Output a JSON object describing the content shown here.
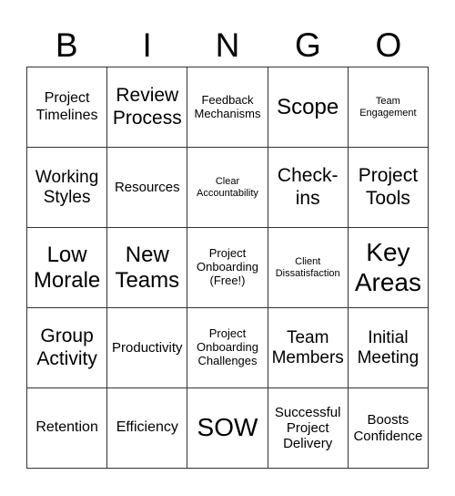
{
  "header": [
    "B",
    "I",
    "N",
    "G",
    "O"
  ],
  "cells": [
    {
      "text": "Project\nTimelines",
      "size": "s16"
    },
    {
      "text": "Review\nProcess",
      "size": "s21"
    },
    {
      "text": "Feedback\nMechanisms",
      "size": "s13"
    },
    {
      "text": "Scope",
      "size": "s24"
    },
    {
      "text": "Team\nEngagement",
      "size": "s12"
    },
    {
      "text": "Working\nStyles",
      "size": "s19"
    },
    {
      "text": "Resources",
      "size": "s15"
    },
    {
      "text": "Clear\nAccountability",
      "size": "s12"
    },
    {
      "text": "Check-\nins",
      "size": "s21"
    },
    {
      "text": "Project\nTools",
      "size": "s21"
    },
    {
      "text": "Low\nMorale",
      "size": "s24"
    },
    {
      "text": "New\nTeams",
      "size": "s24"
    },
    {
      "text": "Project\nOnboarding\n(Free!)",
      "size": "s13"
    },
    {
      "text": "Client\nDissatisfaction",
      "size": "s12"
    },
    {
      "text": "Key\nAreas",
      "size": "s28"
    },
    {
      "text": "Group\nActivity",
      "size": "s21"
    },
    {
      "text": "Productivity",
      "size": "s15"
    },
    {
      "text": "Project\nOnboarding\nChallenges",
      "size": "s13"
    },
    {
      "text": "Team\nMembers",
      "size": "s19"
    },
    {
      "text": "Initial\nMeeting",
      "size": "s19"
    },
    {
      "text": "Retention",
      "size": "s16"
    },
    {
      "text": "Efficiency",
      "size": "s16"
    },
    {
      "text": "SOW",
      "size": "s28"
    },
    {
      "text": "Successful\nProject\nDelivery",
      "size": "s15"
    },
    {
      "text": "Boosts\nConfidence",
      "size": "s15"
    }
  ]
}
